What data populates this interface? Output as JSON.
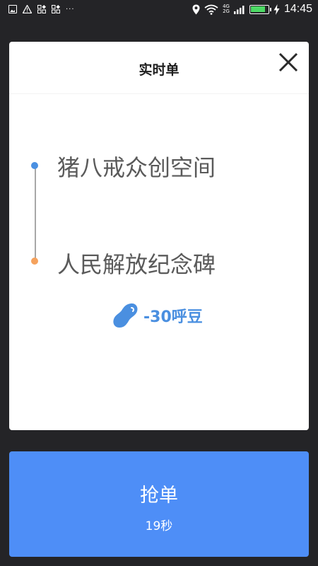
{
  "status_bar": {
    "time": "14:45",
    "network_top": "4G",
    "network_bottom": "2G",
    "icons": [
      "image-icon",
      "warning-icon",
      "app-icon",
      "app-icon",
      "more-icon",
      "location-icon",
      "wifi-icon",
      "signal-icon",
      "battery-icon",
      "charging-icon"
    ]
  },
  "card": {
    "title": "实时单",
    "close_icon": "close-icon",
    "route": {
      "start": "猪八戒众创空间",
      "end": "人民解放纪念碑",
      "start_color": "#4a90e2",
      "end_color": "#f5a25d"
    },
    "beans": {
      "icon": "bean-icon",
      "value": "-30呼豆",
      "color": "#4a8fe0"
    }
  },
  "grab_button": {
    "label": "抢单",
    "countdown": "19秒",
    "color": "#4e8ef7"
  }
}
